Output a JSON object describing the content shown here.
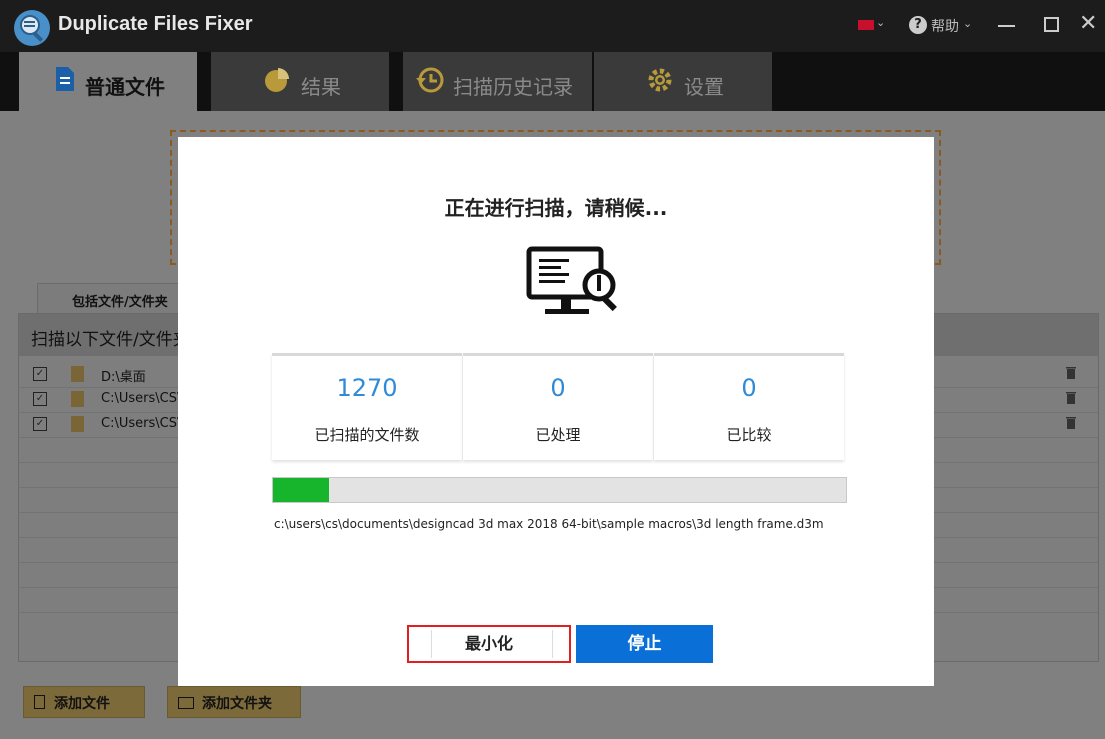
{
  "app": {
    "title": "Duplicate Files Fixer",
    "help_label": "帮助"
  },
  "tabs": [
    {
      "label": "普通文件",
      "active": true
    },
    {
      "label": "结果",
      "active": false
    },
    {
      "label": "扫描历史记录",
      "active": false
    },
    {
      "label": "设置",
      "active": false
    }
  ],
  "background": {
    "include_tab": "包括文件/文件夹",
    "panel_header": "扫描以下文件/文件夹",
    "rows": [
      {
        "checked": true,
        "path": "D:\\桌面"
      },
      {
        "checked": true,
        "path": "C:\\Users\\CS\\"
      },
      {
        "checked": true,
        "path": "C:\\Users\\CS\\"
      }
    ],
    "add_file_label": "添加文件",
    "add_folder_label": "添加文件夹"
  },
  "modal": {
    "title": "正在进行扫描，请稍候...",
    "stats": [
      {
        "value": "1270",
        "label": "已扫描的文件数"
      },
      {
        "value": "0",
        "label": "已处理"
      },
      {
        "value": "0",
        "label": "已比较"
      }
    ],
    "progress_fraction": 0.097,
    "current_file": "c:\\users\\cs\\documents\\designcad 3d max 2018 64-bit\\sample macros\\3d length frame.d3m",
    "minimize_label": "最小化",
    "stop_label": "停止"
  },
  "colors": {
    "accent": "#0a6fd6",
    "progress": "#17b52c",
    "number": "#2f8ad8",
    "highlight": "#e02020"
  }
}
